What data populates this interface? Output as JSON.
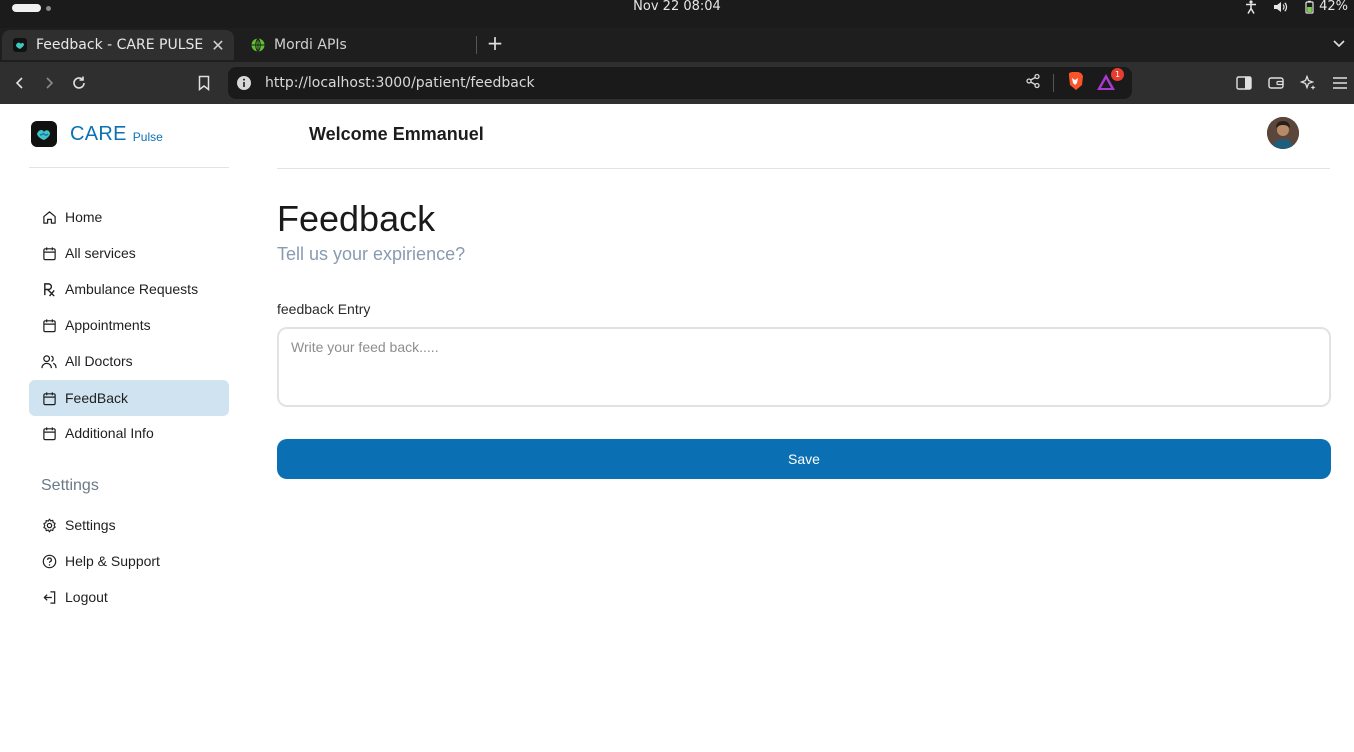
{
  "os": {
    "clock": "Nov 22  08:04",
    "battery": "42%"
  },
  "browser": {
    "tabs": [
      {
        "title": "Feedback - CARE PULSE",
        "close": "✕",
        "active": true
      },
      {
        "title": "Mordi APIs",
        "active": false
      }
    ],
    "new_tab": "+",
    "url": "http://localhost:3000/patient/feedback",
    "notification_count": "1"
  },
  "app": {
    "logo": {
      "care": "CARE",
      "pulse": "Pulse"
    },
    "nav": [
      {
        "label": "Home",
        "icon": "home-icon"
      },
      {
        "label": "All services",
        "icon": "calendar-icon"
      },
      {
        "label": "Ambulance Requests",
        "icon": "rx-icon"
      },
      {
        "label": "Appointments",
        "icon": "calendar-icon"
      },
      {
        "label": "All Doctors",
        "icon": "users-icon"
      },
      {
        "label": "FeedBack",
        "icon": "calendar-icon",
        "active": true
      },
      {
        "label": "Additional Info",
        "icon": "calendar-icon"
      }
    ],
    "settings_heading": "Settings",
    "settings_nav": [
      {
        "label": "Settings",
        "icon": "gear-icon"
      },
      {
        "label": "Help & Support",
        "icon": "help-icon"
      },
      {
        "label": "Logout",
        "icon": "logout-icon"
      }
    ],
    "welcome": "Welcome Emmanuel",
    "accent_color": "#0b6fb3",
    "active_nav_bg": "#cfe4f0"
  },
  "main": {
    "title": "Feedback",
    "subtitle": "Tell us your expirience?",
    "field_label": "feedback Entry",
    "input_value": "",
    "input_placeholder": "Write your feed back.....",
    "save_label": "Save"
  }
}
